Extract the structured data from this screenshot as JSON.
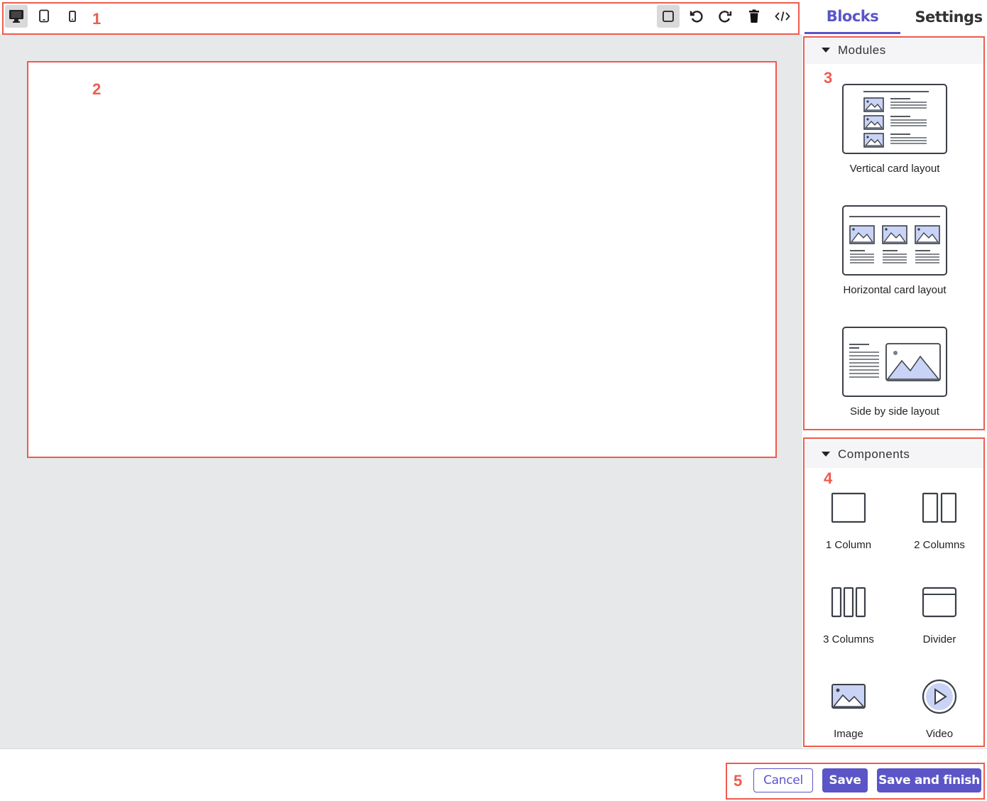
{
  "toolbar": {
    "device_buttons": [
      {
        "icon": "desktop-icon",
        "active": true
      },
      {
        "icon": "tablet-icon",
        "active": false
      },
      {
        "icon": "mobile-icon",
        "active": false
      }
    ],
    "action_buttons": [
      {
        "icon": "square-outline-icon",
        "active": true
      },
      {
        "icon": "undo-icon",
        "active": false
      },
      {
        "icon": "redo-icon",
        "active": false
      },
      {
        "icon": "trash-icon",
        "active": false
      },
      {
        "icon": "code-icon",
        "active": false
      }
    ]
  },
  "panel": {
    "tabs": [
      {
        "label": "Blocks",
        "active": true
      },
      {
        "label": "Settings",
        "active": false
      }
    ],
    "modules": {
      "title": "Modules",
      "items": [
        {
          "label": "Vertical card layout",
          "icon": "vertical-card-layout-icon"
        },
        {
          "label": "Horizontal card layout",
          "icon": "horizontal-card-layout-icon"
        },
        {
          "label": "Side by side layout",
          "icon": "side-by-side-layout-icon"
        }
      ]
    },
    "components": {
      "title": "Components",
      "items": [
        {
          "label": "1 Column",
          "icon": "one-column-icon"
        },
        {
          "label": "2 Columns",
          "icon": "two-columns-icon"
        },
        {
          "label": "3 Columns",
          "icon": "three-columns-icon"
        },
        {
          "label": "Divider",
          "icon": "divider-icon"
        },
        {
          "label": "Image",
          "icon": "image-icon"
        },
        {
          "label": "Video",
          "icon": "video-play-icon"
        }
      ]
    }
  },
  "footer": {
    "cancel_label": "Cancel",
    "save_label": "Save",
    "save_finish_label": "Save and finish"
  },
  "annotations": [
    "1",
    "2",
    "3",
    "4",
    "5"
  ],
  "colors": {
    "accent": "#5b55c7",
    "annotation": "#ef5b4f",
    "canvas_bg": "#e7e8ea",
    "icon_fill": "#c9d3f5",
    "icon_stroke": "#3b4048"
  }
}
